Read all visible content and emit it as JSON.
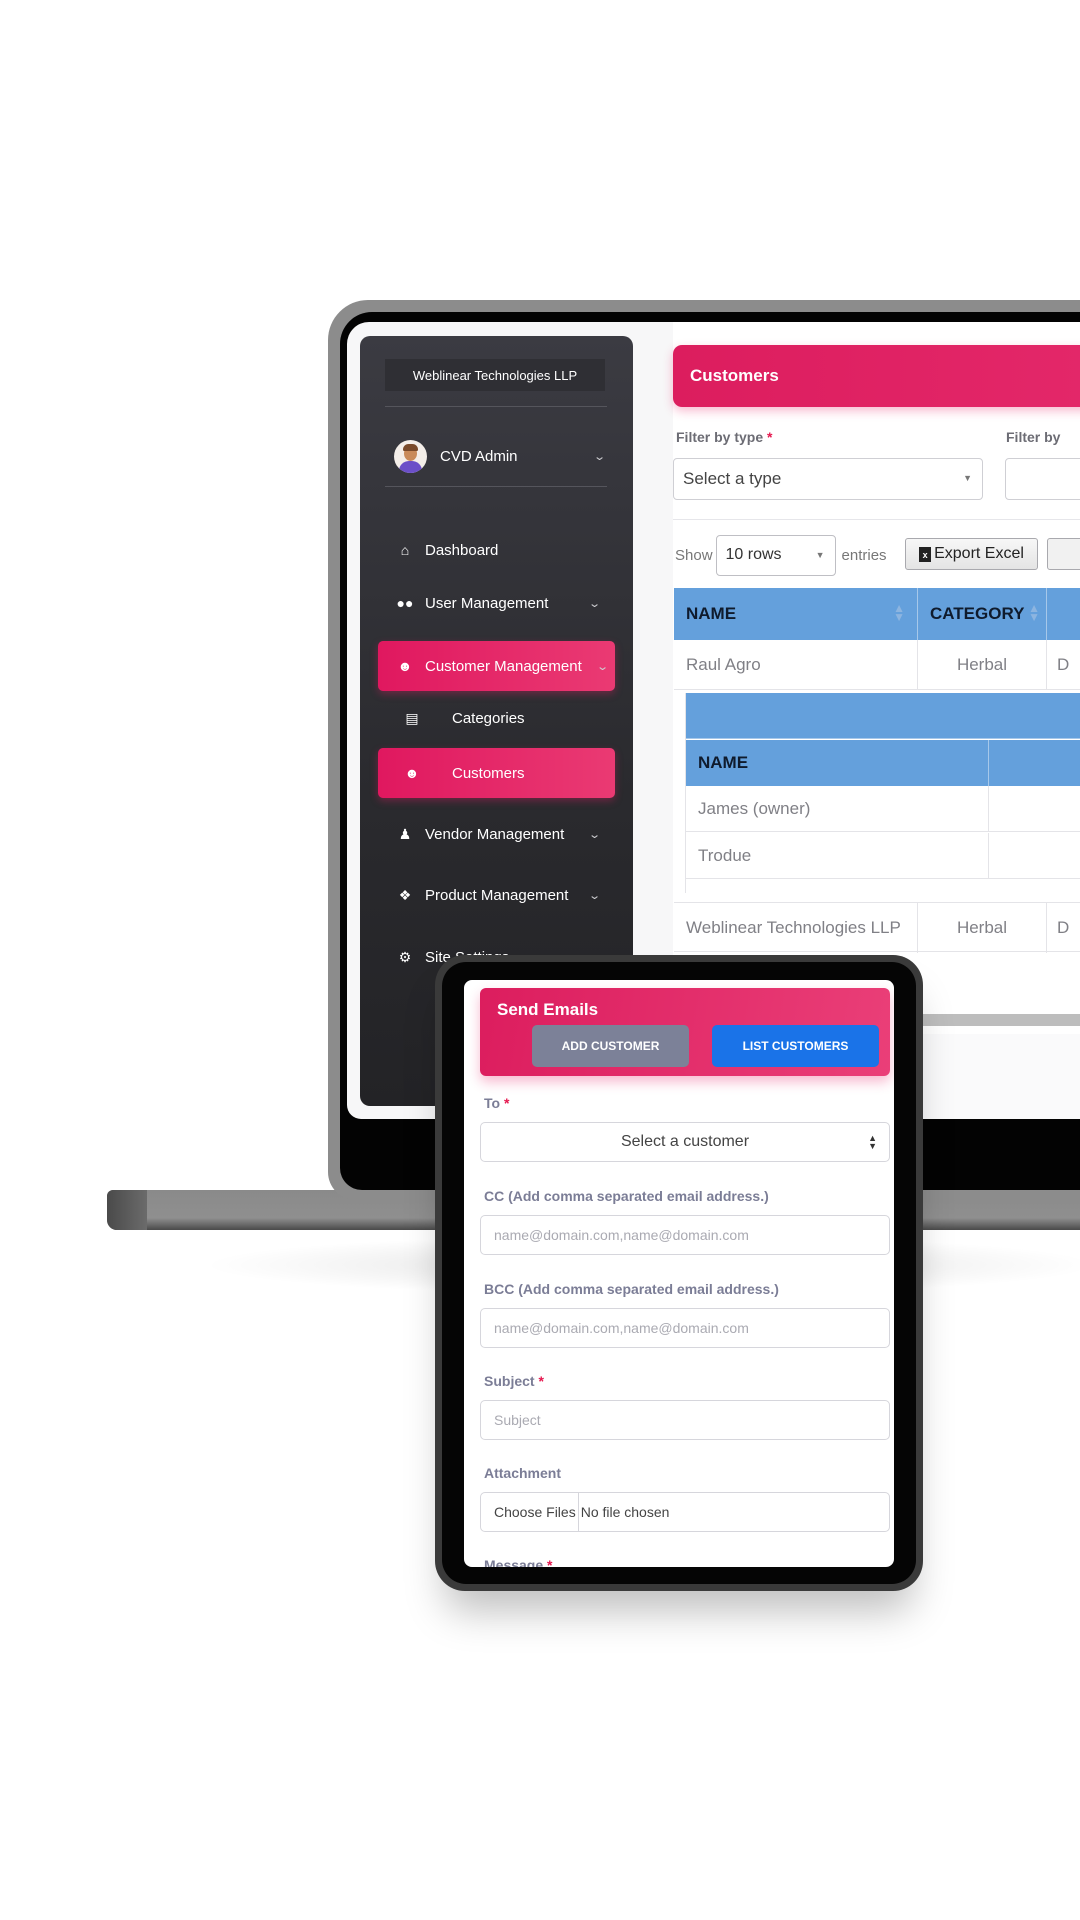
{
  "sidebar": {
    "brand": "Weblinear Technologies LLP",
    "user": {
      "name": "CVD Admin",
      "avatar": "avatar-person"
    },
    "items": [
      {
        "label": "Dashboard",
        "icon": "home-icon",
        "chevron": false,
        "active": false
      },
      {
        "label": "User Management",
        "icon": "users-icon",
        "chevron": true,
        "active": false
      },
      {
        "label": "Customer Management",
        "icon": "user-outline-icon",
        "chevron": true,
        "active": true
      },
      {
        "label": "Categories",
        "icon": "list-icon",
        "chevron": false,
        "active": false,
        "sub": true
      },
      {
        "label": "Customers",
        "icon": "user-outline-icon",
        "chevron": false,
        "active": true,
        "sub": true
      },
      {
        "label": "Vendor Management",
        "icon": "user-icon",
        "chevron": true,
        "active": false
      },
      {
        "label": "Product Management",
        "icon": "cubes-icon",
        "chevron": true,
        "active": false
      },
      {
        "label": "Site Settings",
        "icon": "cogs-icon",
        "chevron": false,
        "active": false
      }
    ]
  },
  "customers_page": {
    "title": "Customers",
    "filter_type_label": "Filter by type",
    "filter_type_value": "Select a type",
    "filter_second_label": "Filter by",
    "required_mark": "*",
    "show_label": "Show",
    "rows_value": "10 rows",
    "entries_label": "entries",
    "export_excel": "Export Excel",
    "table": {
      "columns": [
        "NAME",
        "CATEGORY"
      ],
      "rows": [
        {
          "name": "Raul Agro",
          "category": "Herbal",
          "extra": "D"
        },
        {
          "name": "Weblinear Technologies LLP",
          "category": "Herbal",
          "extra": "D"
        }
      ],
      "nested": {
        "columns": [
          "NAME"
        ],
        "rows": [
          "James (owner)",
          "Trodue"
        ]
      }
    }
  },
  "send_emails": {
    "title": "Send Emails",
    "add_customer": "ADD CUSTOMER",
    "list_customers": "LIST CUSTOMERS",
    "to_label": "To",
    "to_value": "Select a customer",
    "cc_label": "CC (Add comma separated email address.)",
    "cc_placeholder": "name@domain.com,name@domain.com",
    "bcc_label": "BCC (Add comma separated email address.)",
    "bcc_placeholder": "name@domain.com,name@domain.com",
    "subject_label": "Subject",
    "subject_placeholder": "Subject",
    "attachment_label": "Attachment",
    "choose_files": "Choose Files",
    "no_file": "No file chosen",
    "message_label": "Message",
    "required_mark": "*"
  },
  "colors": {
    "accent_pink": "#e91e63",
    "header_blue": "#64a0dc",
    "button_blue": "#1a73e8",
    "button_gray": "#7c8198",
    "sidebar_dark": "#2a2a2e"
  }
}
